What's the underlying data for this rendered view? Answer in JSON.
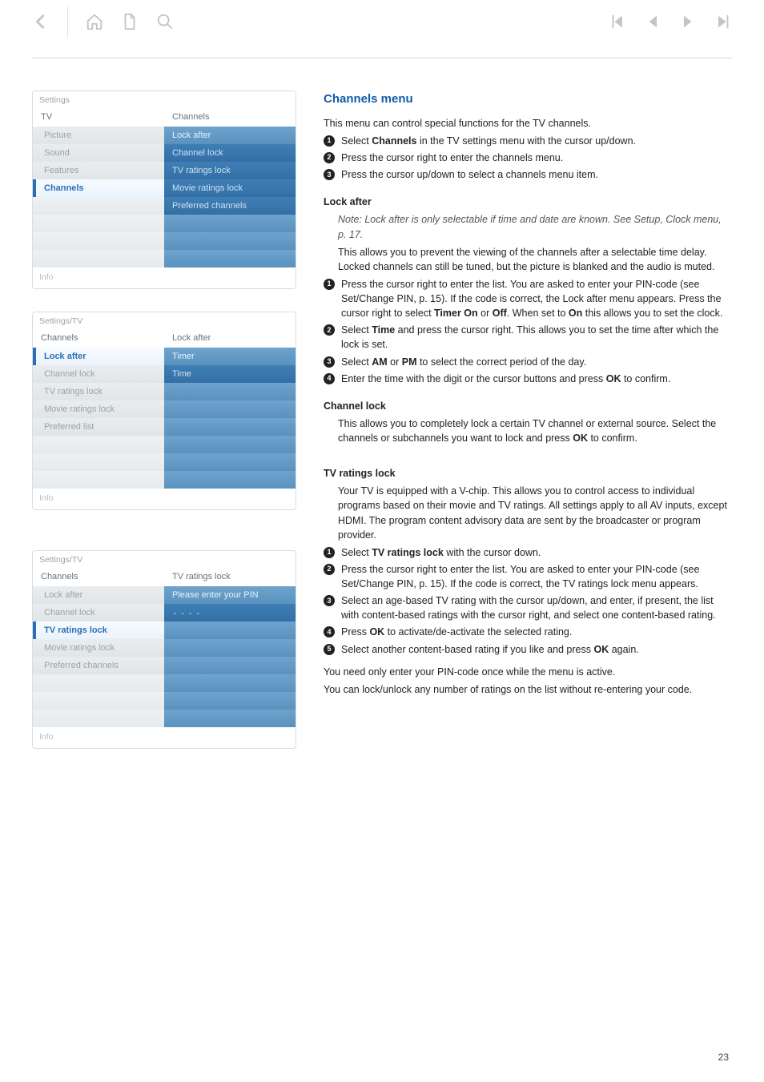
{
  "pageNumber": "23",
  "card1": {
    "title": "Settings",
    "leftHeader": "TV",
    "rightHeader": "Channels",
    "leftItems": [
      "Picture",
      "Sound",
      "Features",
      "Channels"
    ],
    "leftSelectedIndex": 3,
    "rightItems": [
      "Lock after",
      "Channel lock",
      "TV ratings lock",
      "Movie ratings lock",
      "Preferred channels"
    ],
    "footer": "Info"
  },
  "card2": {
    "title": "Settings/TV",
    "leftHeader": "Channels",
    "rightHeader": "Lock after",
    "leftItems": [
      "Lock after",
      "Channel lock",
      "TV ratings lock",
      "Movie ratings lock",
      "Preferred list"
    ],
    "leftSelectedIndex": 0,
    "rightItems": [
      "Timer",
      "Time"
    ],
    "footer": "Info"
  },
  "card3": {
    "title": "Settings/TV",
    "leftHeader": "Channels",
    "rightHeader": "TV ratings lock",
    "leftItems": [
      "Lock after",
      "Channel lock",
      "TV ratings lock",
      "Movie ratings lock",
      "Preferred channels"
    ],
    "leftSelectedIndex": 2,
    "rightItems": [
      "Please enter your PIN",
      "----"
    ],
    "footer": "Info"
  },
  "content": {
    "title": "Channels menu",
    "intro": "This menu can control special functions for the TV channels.",
    "introSteps": {
      "s1a": "Select ",
      "s1b": "Channels",
      "s1c": " in the TV settings menu with the cursor up/down.",
      "s2": "Press the cursor right to enter the channels menu.",
      "s3": "Press the cursor up/down to select a channels menu item."
    },
    "lockAfter": {
      "heading": "Lock after",
      "note": "Note: Lock after is only selectable if time and date are known. See Setup, Clock menu, p. 17.",
      "desc": "This allows you to prevent the viewing of the channels after a selectable time delay. Locked channels can still be tuned, but the picture is blanked and the audio is muted.",
      "s1a": "Press the cursor right to enter the list. You are asked to enter your PIN-code (see Set/Change PIN, p. 15). If the code is correct, the Lock after menu appears. Press the cursor right to select ",
      "s1b": "Timer On",
      "s1c": " or ",
      "s1d": "Off",
      "s1e": ". When set to ",
      "s1f": "On",
      "s1g": " this allows you to set the clock.",
      "s2a": "Select ",
      "s2b": "Time",
      "s2c": " and press the cursor right. This allows you to set the time after which the lock is set.",
      "s3a": "Select ",
      "s3b": "AM",
      "s3c": " or ",
      "s3d": "PM",
      "s3e": " to select the correct period of the day.",
      "s4a": "Enter the time with the digit or the cursor buttons and press ",
      "s4b": "OK",
      "s4c": " to confirm."
    },
    "channelLock": {
      "heading": "Channel lock",
      "descA": "This allows you to completely lock a certain TV channel or external source. Select the channels or subchannels you want to lock and press ",
      "descB": "OK",
      "descC": " to confirm."
    },
    "tvRatings": {
      "heading": "TV ratings lock",
      "desc": "Your TV is equipped with a V-chip. This allows you to control access to individual programs based on their movie and TV ratings. All settings apply to all AV inputs, except HDMI. The program content advisory data are sent by the broadcaster or program provider.",
      "s1a": "Select ",
      "s1b": "TV ratings lock",
      "s1c": " with the cursor down.",
      "s2": "Press the cursor right to enter the list. You are asked to enter your PIN-code (see Set/Change PIN, p. 15). If the code is correct, the TV ratings lock menu appears.",
      "s3": "Select an age-based TV rating with the cursor up/down, and enter, if present, the list with content-based ratings with the cursor right, and select one content-based rating.",
      "s4a": "Press ",
      "s4b": "OK",
      "s4c": " to activate/de-activate the selected rating.",
      "s5a": "Select another content-based rating if you like and press ",
      "s5b": "OK",
      "s5c": " again.",
      "tail1": "You need only enter your PIN-code once while the menu is active.",
      "tail2": "You can lock/unlock any number of ratings on the list without re-entering your code."
    }
  }
}
